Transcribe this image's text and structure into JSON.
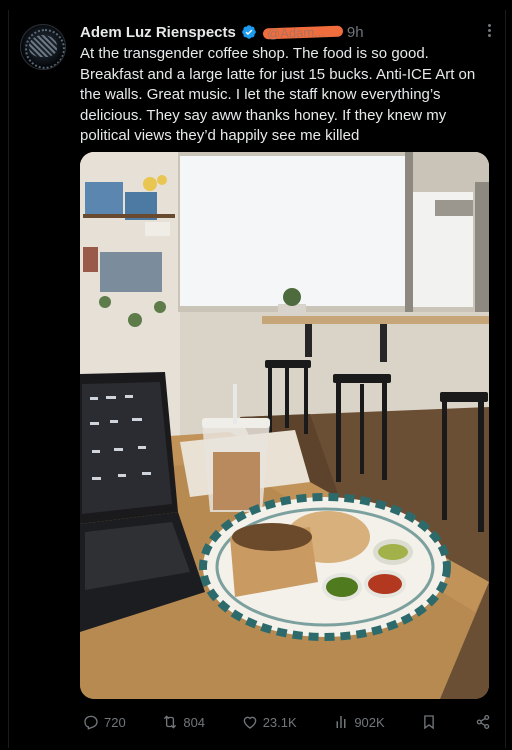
{
  "post": {
    "author_name": "Adem Luz Rienspects",
    "verified_icon": "verified-badge-icon",
    "handle": "@Adam...",
    "time": "9h",
    "text": "At the transgender coffee shop. The food is so good. Breakfast and a large latte for just 15 bucks. Anti-ICE Art on the walls. Great music. I let the staff know everything’s delicious. They say aww thanks honey. If they knew my political views they’d happily see me killed"
  },
  "actions": {
    "replies": "720",
    "reposts": "804",
    "likes": "23.1K",
    "views": "902K"
  },
  "colors": {
    "background": "#000000",
    "text": "#e7e9ea",
    "muted": "#71767b",
    "verified": "#1d9bf0",
    "redaction": "#f26d3d"
  }
}
